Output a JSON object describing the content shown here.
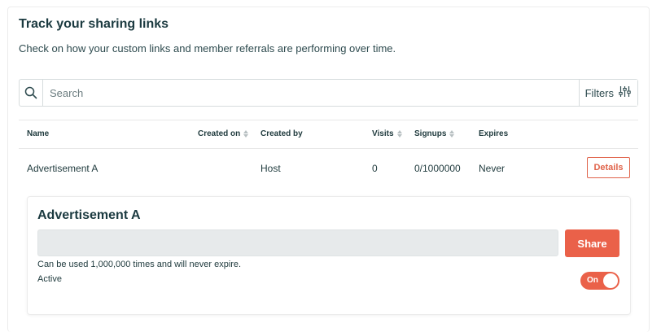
{
  "page": {
    "title": "Track your sharing links",
    "subtitle": "Check on how your custom links and member referrals are performing over time."
  },
  "search": {
    "placeholder": "Search",
    "value": "",
    "filters_label": "Filters"
  },
  "table": {
    "columns": [
      {
        "label": "Name",
        "sortable": false
      },
      {
        "label": "Created on",
        "sortable": true
      },
      {
        "label": "Created by",
        "sortable": false
      },
      {
        "label": "Visits",
        "sortable": true
      },
      {
        "label": "Signups",
        "sortable": true
      },
      {
        "label": "Expires",
        "sortable": false
      }
    ],
    "rows": [
      {
        "name": "Advertisement A",
        "created_on": "",
        "created_by": "Host",
        "visits": "0",
        "signups": "0/1000000",
        "expires": "Never",
        "action_label": "Details"
      }
    ]
  },
  "detail": {
    "title": "Advertisement A",
    "link_value": "",
    "share_label": "Share",
    "usage_note": "Can be used 1,000,000 times and will never expire.",
    "active_label": "Active",
    "toggle_label": "On",
    "toggle_state": true
  },
  "colors": {
    "accent": "#ea6149",
    "text_dark": "#1b3a40",
    "border": "#d6dcdd",
    "field_bg": "#e7eaeb"
  },
  "icons": {
    "search": "search-icon",
    "filters": "sliders-icon",
    "sort": "sort-icon"
  }
}
